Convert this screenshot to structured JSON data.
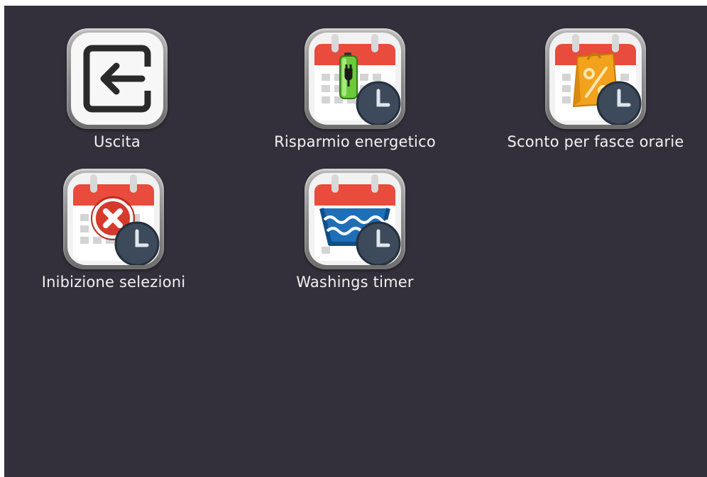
{
  "menu": {
    "items": [
      {
        "id": "exit",
        "label": "Uscita",
        "icon": "exit-icon"
      },
      {
        "id": "energy-saving",
        "label": "Risparmio energetico",
        "icon": "calendar-battery-clock-icon"
      },
      {
        "id": "time-discount",
        "label": "Sconto per fasce orarie",
        "icon": "calendar-shopping-bag-clock-icon"
      },
      {
        "id": "inhibit-selections",
        "label": "Inibizione selezioni",
        "icon": "calendar-cancel-clock-icon"
      },
      {
        "id": "washings-timer",
        "label": "Washings timer",
        "icon": "calendar-washing-clock-icon"
      }
    ]
  },
  "colors": {
    "background": "#33303b",
    "label_text": "#f2f2f2",
    "calendar_red": "#e94b3c",
    "clock_face": "#3c4a5c",
    "battery_green": "#6cc93a",
    "bag_orange": "#f2a21d",
    "cancel_red": "#d63a2c",
    "water_blue": "#1f6fb7"
  }
}
